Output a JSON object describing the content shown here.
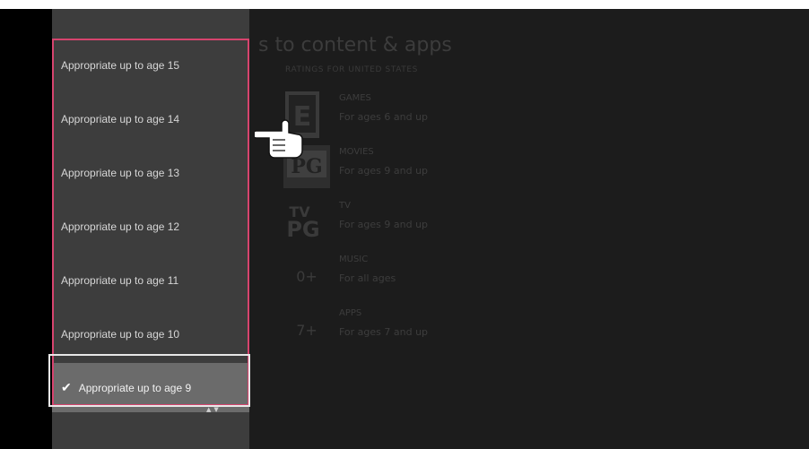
{
  "background": {
    "title": "s to content & apps",
    "subtitle": "RATINGS FOR UNITED STATES",
    "ratings": [
      {
        "badge": "E",
        "category": "GAMES",
        "description": "For ages 6 and up"
      },
      {
        "badge": "PG",
        "category": "MOVIES",
        "description": "For ages 9 and up"
      },
      {
        "badge": "TV PG",
        "category": "TV",
        "description": "For ages 9 and up"
      },
      {
        "badge": "0+",
        "category": "MUSIC",
        "description": "For all ages"
      },
      {
        "badge": "7+",
        "category": "APPS",
        "description": "For ages 7 and up"
      }
    ]
  },
  "dropdown": {
    "items": [
      {
        "label": "Appropriate up to age 15"
      },
      {
        "label": "Appropriate up to age 14"
      },
      {
        "label": "Appropriate up to age 13"
      },
      {
        "label": "Appropriate up to age 12"
      },
      {
        "label": "Appropriate up to age 11"
      },
      {
        "label": "Appropriate up to age 10"
      }
    ],
    "selected": {
      "label": "Appropriate up to age 9",
      "check": "✔"
    },
    "scroll_arrows": "▲▼"
  },
  "colors": {
    "focus_outline": "#d6446e",
    "panel": "#3d3d3d",
    "selected_bg": "#6b6b6b"
  }
}
